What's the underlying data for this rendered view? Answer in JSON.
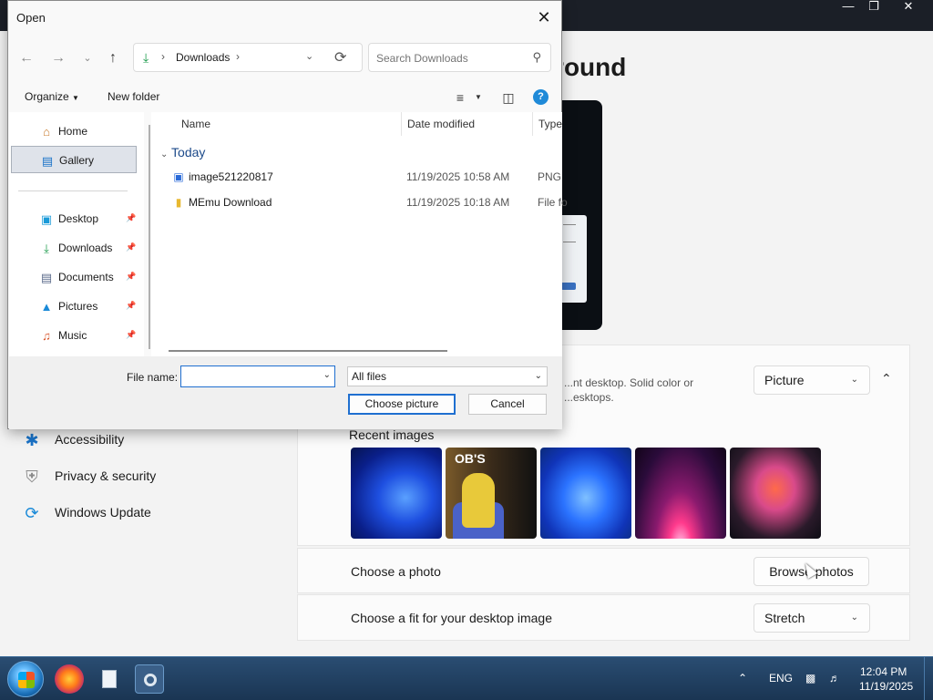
{
  "settings": {
    "heading": "Background",
    "personalize_dropdown": "Picture",
    "personalize_desc": "...nt desktop. Solid color or ...esktops.",
    "recent_images_label": "Recent images",
    "thumb2_text": "OB'S",
    "choose_photo_label": "Choose a photo",
    "browse_button": "Browse photos",
    "fit_label": "Choose a fit for your desktop image",
    "fit_dropdown": "Stretch",
    "nav": [
      {
        "label": "Accessibility",
        "icon": "accessibility-icon"
      },
      {
        "label": "Privacy & security",
        "icon": "shield-icon"
      },
      {
        "label": "Windows Update",
        "icon": "update-icon"
      }
    ]
  },
  "dialog": {
    "title": "Open",
    "address": {
      "location": "Downloads"
    },
    "search_placeholder": "Search Downloads",
    "toolbar": {
      "organize": "Organize",
      "new_folder": "New folder"
    },
    "nav_tree": [
      {
        "label": "Home",
        "icon": "home-icon",
        "pinned": false
      },
      {
        "label": "Gallery",
        "icon": "gallery-icon",
        "pinned": false,
        "selected": true
      },
      {
        "label": "Desktop",
        "icon": "desktop-icon",
        "pinned": true
      },
      {
        "label": "Downloads",
        "icon": "download-icon",
        "pinned": true
      },
      {
        "label": "Documents",
        "icon": "documents-icon",
        "pinned": true
      },
      {
        "label": "Pictures",
        "icon": "pictures-icon",
        "pinned": true
      },
      {
        "label": "Music",
        "icon": "music-icon",
        "pinned": true
      }
    ],
    "columns": {
      "name": "Name",
      "date": "Date modified",
      "type": "Type"
    },
    "group": "Today",
    "files": [
      {
        "name": "image521220817",
        "date": "11/19/2025 10:58 AM",
        "type": "PNG",
        "icon": "image-file-icon"
      },
      {
        "name": "MEmu Download",
        "date": "11/19/2025 10:18 AM",
        "type": "File fo",
        "icon": "folder-icon"
      }
    ],
    "file_name_label": "File name:",
    "file_name_value": "",
    "filter": "All files",
    "choose_button": "Choose picture",
    "cancel_button": "Cancel"
  },
  "taskbar": {
    "language": "ENG",
    "time": "12:04 PM",
    "date": "11/19/2025"
  }
}
